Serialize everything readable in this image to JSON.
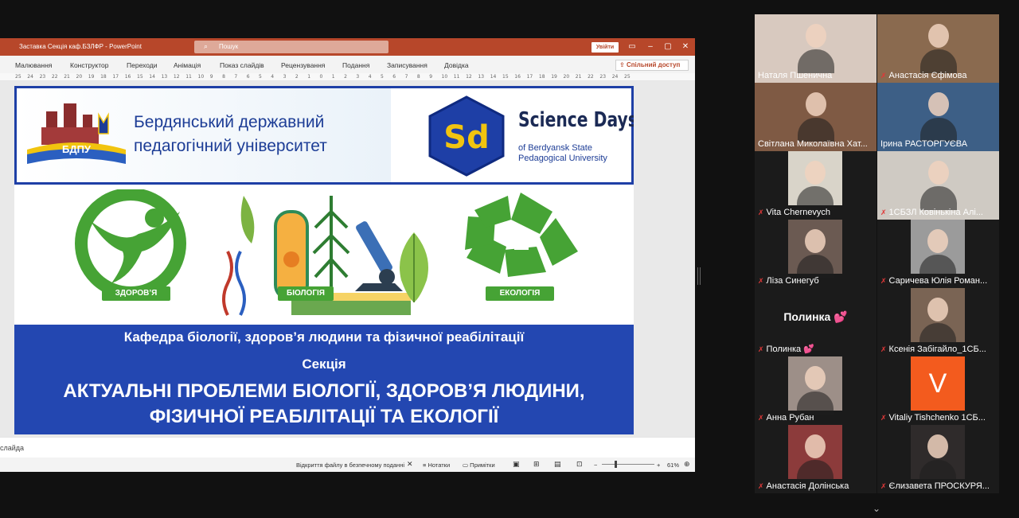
{
  "ppt": {
    "doc_title": "Заставка Секція каф.БЗЛФР  -  PowerPoint",
    "search_placeholder": "Пошук",
    "signin": "Увійти",
    "ribbon_tabs": [
      "Малювання",
      "Конструктор",
      "Переходи",
      "Анімація",
      "Показ слайдів",
      "Рецензування",
      "Подання",
      "Записування",
      "Довідка"
    ],
    "share": "Спільний доступ",
    "ruler": [
      "25",
      "24",
      "23",
      "22",
      "21",
      "20",
      "19",
      "18",
      "17",
      "16",
      "15",
      "14",
      "13",
      "12",
      "11",
      "10",
      "9",
      "8",
      "7",
      "6",
      "5",
      "4",
      "3",
      "2",
      "1",
      "0",
      "1",
      "2",
      "3",
      "4",
      "5",
      "6",
      "7",
      "8",
      "9",
      "10",
      "11",
      "12",
      "13",
      "14",
      "15",
      "16",
      "17",
      "18",
      "19",
      "20",
      "21",
      "22",
      "23",
      "24",
      "25"
    ],
    "notes_placeholder": "слайда",
    "status": {
      "protected": "Відкриття файлу в безпечному поданні",
      "notes": "Нотатки",
      "comments": "Примітки",
      "zoom_minus": "−",
      "zoom_plus": "+",
      "zoom": "61%"
    }
  },
  "slide": {
    "logo_text": "БДПУ",
    "university_line1": "Бердянський державний",
    "university_line2": "педагогічний університет",
    "sd_logo": "Sd",
    "sd_title": "Science Days",
    "sd_sub1": "of Berdyansk State",
    "sd_sub2": "Pedagogical University",
    "label_health": "ЗДОРОВ’Я",
    "label_bio": "БІОЛОГІЯ",
    "label_eco": "ЕКОЛОГІЯ",
    "department": "Кафедра біології, здоров’я людини та фізичної реабілітації",
    "section": "Секція",
    "topic_line1": "АКТУАЛЬНІ ПРОБЛЕМИ БІОЛОГІЇ, ЗДОРОВ’Я ЛЮДИНИ,",
    "topic_line2": "ФІЗИЧНОЇ РЕАБІЛІТАЦІЇ ТА ЕКОЛОГІЇ"
  },
  "participants": [
    {
      "name": "Наталя Пшенична",
      "muted": false,
      "active": false,
      "bg": "#d8c9bf"
    },
    {
      "name": "Анастасія Єфімова",
      "muted": true,
      "active": false,
      "bg": "#8a6a4f"
    },
    {
      "name": "Світлана Миколаївна Хат...",
      "muted": false,
      "active": true,
      "bg": "#7f5a44"
    },
    {
      "name": "Ірина РАСТОРГУЄВА",
      "muted": false,
      "active": false,
      "bg": "#3d5f86"
    },
    {
      "name": "Vita Chernevych",
      "muted": true,
      "active": false,
      "bg": "#d9d4c9"
    },
    {
      "name": "1СБЗЛ Ковінькіна Алі...",
      "muted": true,
      "active": false,
      "bg": "#cfcac3"
    },
    {
      "name": "Ліза Синегуб",
      "muted": true,
      "active": false,
      "bg": "#6b5a52"
    },
    {
      "name": "Саричева Юлія Роман...",
      "muted": true,
      "active": false,
      "bg": "#9b9b9b"
    },
    {
      "name": "Полинка 💕",
      "muted": true,
      "active": false,
      "bg": "#1b1b1b",
      "text_avatar": "Полинка 💕"
    },
    {
      "name": "Ксенія Забігайло_1СБ...",
      "muted": true,
      "active": false,
      "bg": "#7a6454"
    },
    {
      "name": "Анна Рубан",
      "muted": true,
      "active": false,
      "bg": "#9d8f88"
    },
    {
      "name": "Vitaliy Tishchenko 1СБ...",
      "muted": true,
      "active": false,
      "bg": "#f35b1e",
      "letter": "V"
    },
    {
      "name": "Анастасія Долінська",
      "muted": true,
      "active": false,
      "bg": "#8c3b3b"
    },
    {
      "name": "Єлизавета ПРОСКУРЯ...",
      "muted": true,
      "active": false,
      "bg": "#2f2b2b"
    }
  ],
  "colors": {
    "ppt_accent": "#b7472a",
    "slide_blue": "#2347b1",
    "eco_green": "#46a335",
    "active_speaker": "#2dcc5b"
  }
}
